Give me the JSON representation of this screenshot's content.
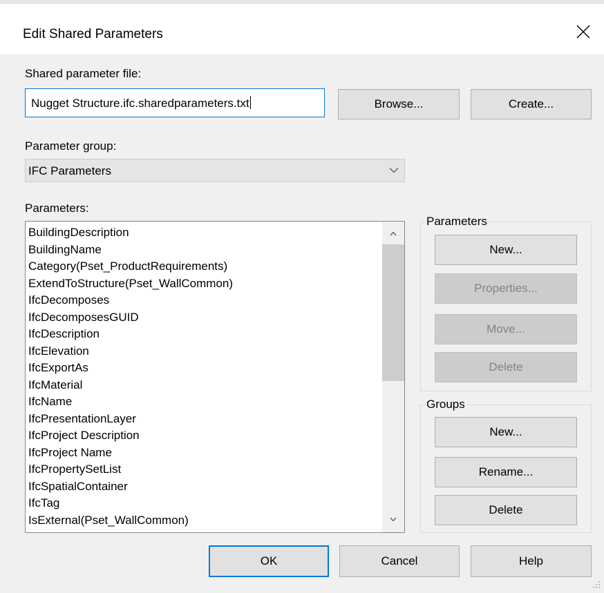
{
  "dialog": {
    "title": "Edit Shared Parameters",
    "accent": "#0078d7"
  },
  "file": {
    "label": "Shared parameter file:",
    "value": "Nugget Structure.ifc.sharedparameters.txt",
    "browse_label": "Browse...",
    "create_label": "Create..."
  },
  "group_select": {
    "label": "Parameter group:",
    "value": "IFC Parameters"
  },
  "parameters_list": {
    "label": "Parameters:",
    "items": [
      "BuildingDescription",
      "BuildingName",
      "Category(Pset_ProductRequirements)",
      "ExtendToStructure(Pset_WallCommon)",
      "IfcDecomposes",
      "IfcDecomposesGUID",
      "IfcDescription",
      "IfcElevation",
      "IfcExportAs",
      "IfcMaterial",
      "IfcName",
      "IfcPresentationLayer",
      "IfcProject Description",
      "IfcProject Name",
      "IfcPropertySetList",
      "IfcSpatialContainer",
      "IfcTag",
      "IsExternal(Pset_WallCommon)"
    ]
  },
  "parameters_box": {
    "title": "Parameters",
    "new_label": "New...",
    "properties_label": "Properties...",
    "move_label": "Move...",
    "delete_label": "Delete"
  },
  "groups_box": {
    "title": "Groups",
    "new_label": "New...",
    "rename_label": "Rename...",
    "delete_label": "Delete"
  },
  "footer": {
    "ok_label": "OK",
    "cancel_label": "Cancel",
    "help_label": "Help"
  }
}
